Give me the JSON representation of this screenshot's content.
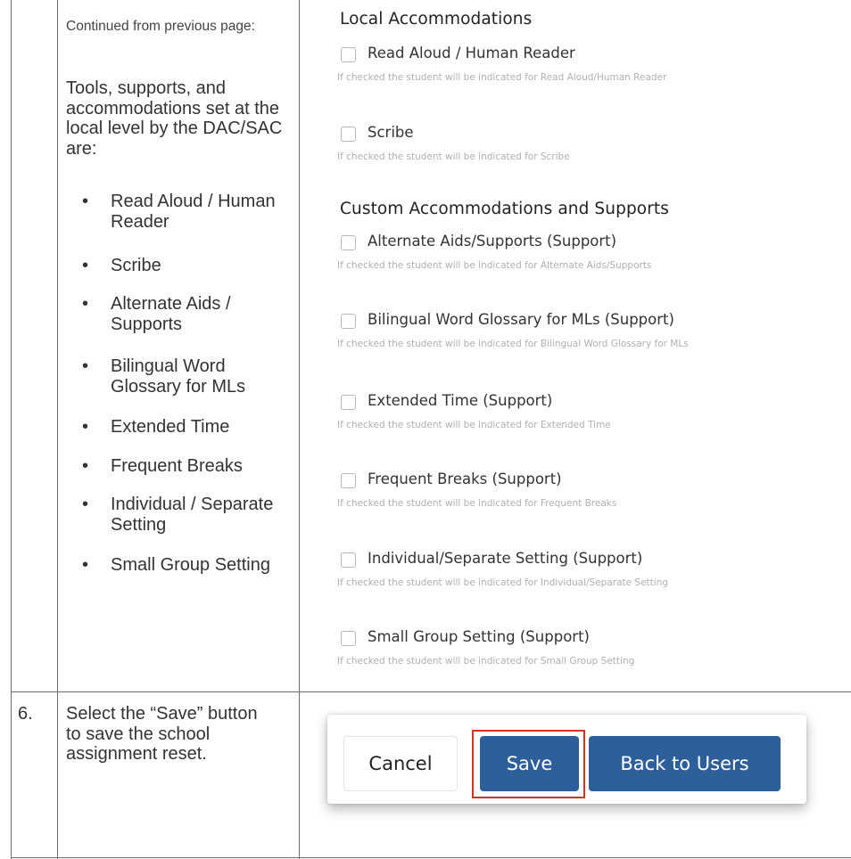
{
  "left_column": {
    "continued_note": "Continued from previous page:",
    "intro": "Tools, supports, and accommodations set at the local level by the DAC/SAC are:",
    "tools": [
      "Read Aloud / Human Reader",
      "Scribe",
      "Alternate Aids / Supports",
      "Bilingual Word Glossary for MLs",
      "Extended Time",
      "Frequent Breaks",
      "Individual / Separate Setting",
      "Small Group Setting"
    ]
  },
  "local_section": {
    "heading": "Local Accommodations",
    "options": [
      {
        "label": "Read Aloud / Human Reader",
        "help": "If checked the student will be indicated for Read Aloud/Human Reader",
        "checked": false
      },
      {
        "label": "Scribe",
        "help": "If checked the student will be indicated for Scribe",
        "checked": false
      }
    ]
  },
  "custom_section": {
    "heading": "Custom Accommodations and Supports",
    "options": [
      {
        "label": "Alternate Aids/Supports (Support)",
        "help": "If checked the student will be indicated for Alternate Aids/Supports",
        "checked": false
      },
      {
        "label": "Bilingual Word Glossary for MLs (Support)",
        "help": "If checked the student will be indicated for Bilingual Word Glossary for MLs",
        "checked": false
      },
      {
        "label": "Extended Time (Support)",
        "help": "If checked the student will be indicated for Extended Time",
        "checked": false
      },
      {
        "label": "Frequent Breaks (Support)",
        "help": "If checked the student will be indicated for Frequent Breaks",
        "checked": false
      },
      {
        "label": "Individual/Separate Setting (Support)",
        "help": "If checked the student will be indicated for Individual/Separate Setting",
        "checked": false
      },
      {
        "label": "Small Group Setting (Support)",
        "help": "If checked the student will be indicated for Small Group Setting",
        "checked": false
      }
    ]
  },
  "step6": {
    "number": "6.",
    "text": "Select the “Save” button to save the school assignment reset."
  },
  "buttons": {
    "cancel": "Cancel",
    "save": "Save",
    "back": "Back to Users",
    "primary_color": "#2d5f9a",
    "highlight_color": "#d9301f"
  }
}
